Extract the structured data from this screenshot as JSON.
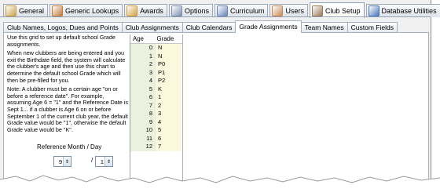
{
  "top_tabs": [
    {
      "label": "General",
      "color": "#c9a14a"
    },
    {
      "label": "Generic Lookups",
      "color": "#c07a3a"
    },
    {
      "label": "Awards",
      "color": "#d0a040"
    },
    {
      "label": "Options",
      "color": "#7d8fb0"
    },
    {
      "label": "Curriculum",
      "color": "#6a86b8"
    },
    {
      "label": "Users",
      "color": "#c58a5a"
    },
    {
      "label": "Club Setup",
      "color": "#9a7a5a"
    },
    {
      "label": "Database Utilities",
      "color": "#4a78b8"
    }
  ],
  "active_top_tab": "Club Setup",
  "sub_tabs": [
    "Club Names, Logos, Dues and Points",
    "Club Assignments",
    "Club Calendars",
    "Grade Assignments",
    "Team Names",
    "Custom Fields"
  ],
  "active_sub_tab": "Grade Assignments",
  "help": {
    "p1": "Use this grid to set up default school Grade assignments.",
    "p2": "When new clubbers are being entered and you exit the Birthdate field, the system will calculate the clubber's age and then use this chart to determine the default school Grade which will then be pre-filled for you.",
    "p3": "Note: A clubber must be a certain age \"on or before a reference date\". For example, assuming Age 6 = \"1\" and the Reference Date is Sept 1... if a clubber is Age 6 on or before September 1 of the current club year, the default Grade value would be \"1\", otherwise the default Grade value would be \"K\"."
  },
  "reference": {
    "label": "Reference Month / Day",
    "month": "9",
    "day": "1"
  },
  "grid": {
    "headers": {
      "age": "Age",
      "grade": "Grade"
    },
    "rows": [
      {
        "age": "0",
        "grade": "N"
      },
      {
        "age": "1",
        "grade": "N"
      },
      {
        "age": "2",
        "grade": "P0"
      },
      {
        "age": "3",
        "grade": "P1"
      },
      {
        "age": "4",
        "grade": "P2"
      },
      {
        "age": "5",
        "grade": "K"
      },
      {
        "age": "6",
        "grade": "1"
      },
      {
        "age": "7",
        "grade": "2"
      },
      {
        "age": "8",
        "grade": "3"
      },
      {
        "age": "9",
        "grade": "4"
      },
      {
        "age": "10",
        "grade": "5"
      },
      {
        "age": "11",
        "grade": "6"
      },
      {
        "age": "12",
        "grade": "7"
      }
    ]
  }
}
